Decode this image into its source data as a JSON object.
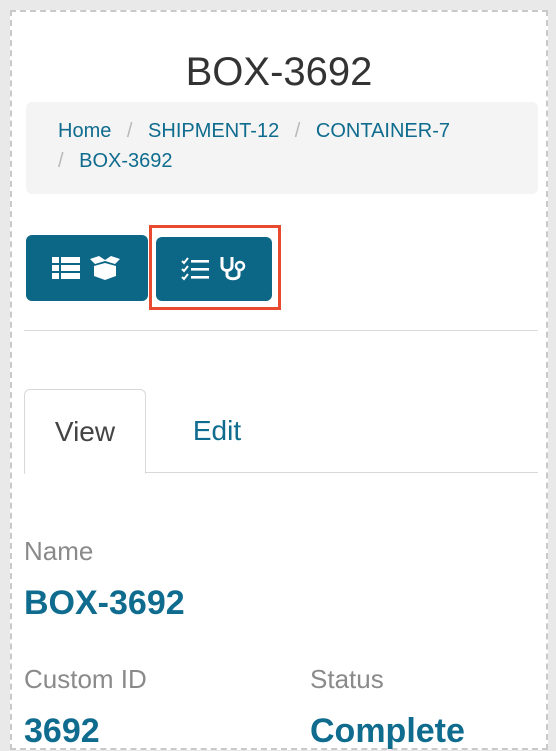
{
  "page": {
    "title": "BOX-3692"
  },
  "breadcrumb": {
    "items": [
      "Home",
      "SHIPMENT-12",
      "CONTAINER-7",
      "BOX-3692"
    ],
    "separator": "/"
  },
  "toolbar": {
    "buttons": [
      {
        "icons": [
          "list-icon",
          "open-box-icon"
        ]
      },
      {
        "icons": [
          "checklist-icon",
          "stethoscope-icon"
        ],
        "highlighted": true
      }
    ]
  },
  "tabs": [
    {
      "label": "View",
      "active": true
    },
    {
      "label": "Edit",
      "active": false
    }
  ],
  "fields": {
    "name": {
      "label": "Name",
      "value": "BOX-3692"
    },
    "custom_id": {
      "label": "Custom ID",
      "value": "3692"
    },
    "status": {
      "label": "Status",
      "value": "Complete"
    }
  },
  "colors": {
    "accent": "#0c6686",
    "link": "#0f6c8e",
    "highlight": "#e84a2f"
  }
}
